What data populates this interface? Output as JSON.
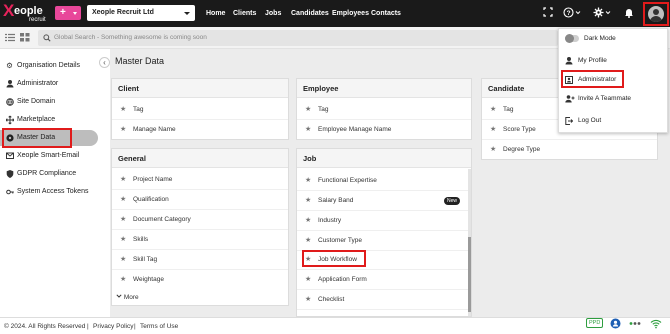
{
  "app": {
    "logo_text": "Xeople",
    "logo_sub": "recruit",
    "add_label": "+",
    "company": "Xeople Recruit Ltd"
  },
  "nav": [
    "Home",
    "Clients",
    "Jobs",
    "Candidates",
    "Employees",
    "Contacts"
  ],
  "top_icons": [
    "fullscreen-icon",
    "help-icon",
    "settings-icon",
    "bell-icon",
    "user-avatar"
  ],
  "search": {
    "placeholder": "Global Search - Something awesome is coming soon"
  },
  "sidebar": {
    "items": [
      {
        "label": "Organisation Details",
        "icon": "building-icon"
      },
      {
        "label": "Administrator",
        "icon": "person-icon"
      },
      {
        "label": "Site Domain",
        "icon": "globe-icon"
      },
      {
        "label": "Marketplace",
        "icon": "move-icon"
      },
      {
        "label": "Master Data",
        "icon": "database-icon",
        "active": true
      },
      {
        "label": "Xeople Smart-Email",
        "icon": "mail-icon"
      },
      {
        "label": "GDPR Compliance",
        "icon": "shield-icon"
      },
      {
        "label": "System Access Tokens",
        "icon": "key-icon"
      }
    ]
  },
  "main": {
    "title": "Master Data",
    "cards": {
      "client": {
        "title": "Client",
        "items": [
          "Tag",
          "Manage Name"
        ]
      },
      "employee": {
        "title": "Employee",
        "items": [
          "Tag",
          "Employee Manage Name"
        ]
      },
      "candidate": {
        "title": "Candidate",
        "items": [
          "Tag",
          "Score Type",
          "Degree Type"
        ]
      },
      "general": {
        "title": "General",
        "items": [
          "Project Name",
          "Qualification",
          "Document Category",
          "Skills",
          "Skill Tag",
          "Weightage"
        ],
        "more": "More"
      },
      "job": {
        "title": "Job",
        "items": [
          "Functional Expertise",
          "Salary Band",
          "Industry",
          "Customer Type",
          "Job Workflow",
          "Application Form",
          "Checklist"
        ],
        "badge": "New"
      }
    }
  },
  "dropdown": {
    "items": [
      {
        "label": "Dark Mode",
        "icon": "toggle-switch"
      },
      {
        "label": "My Profile",
        "icon": "person-icon"
      },
      {
        "label": "Administrator",
        "icon": "admin-icon"
      },
      {
        "label": "Invite A Teammate",
        "icon": "add-user-icon"
      },
      {
        "label": "Log Out",
        "icon": "logout-icon"
      }
    ]
  },
  "footer": {
    "copyright": "© 2024. All Rights Reserved",
    "sep": "|",
    "privacy": "Privacy Policy",
    "terms": "Terms of Use",
    "ppd": "PPD"
  }
}
